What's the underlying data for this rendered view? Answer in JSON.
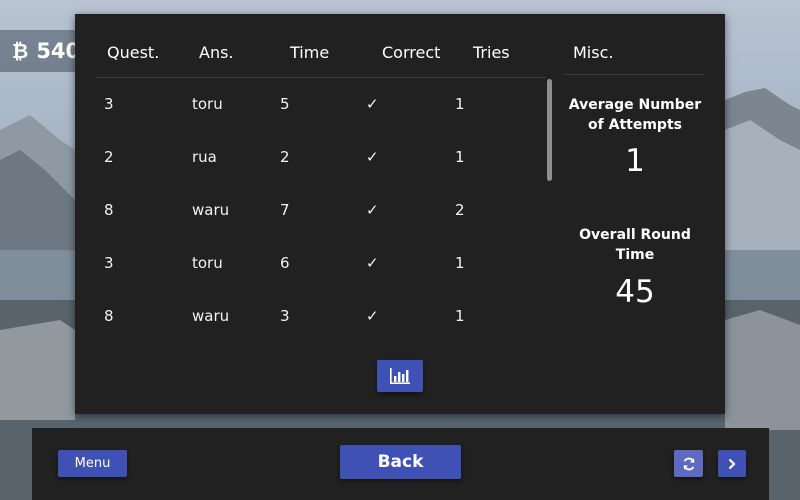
{
  "hud": {
    "coin_icon": "₿",
    "coins": "540"
  },
  "results_table": {
    "headers": {
      "question": "Quest.",
      "answer": "Ans.",
      "time": "Time",
      "correct": "Correct",
      "tries": "Tries"
    },
    "rows": [
      {
        "question": "3",
        "answer": "toru",
        "time": "5",
        "correct": "✓",
        "tries": "1"
      },
      {
        "question": "2",
        "answer": "rua",
        "time": "2",
        "correct": "✓",
        "tries": "1"
      },
      {
        "question": "8",
        "answer": "waru",
        "time": "7",
        "correct": "✓",
        "tries": "2"
      },
      {
        "question": "3",
        "answer": "toru",
        "time": "6",
        "correct": "✓",
        "tries": "1"
      },
      {
        "question": "8",
        "answer": "waru",
        "time": "3",
        "correct": "✓",
        "tries": "1"
      }
    ]
  },
  "misc": {
    "title": "Misc.",
    "avg_attempts_label": "Average Number of Attempts",
    "avg_attempts_value": "1",
    "round_time_label": "Overall Round Time",
    "round_time_value": "45"
  },
  "chart_button": {
    "icon": "bar-chart-icon"
  },
  "footer": {
    "menu_label": "Menu",
    "back_label": "Back",
    "refresh_icon": "refresh-icon",
    "next_icon": "chevron-right-icon"
  },
  "colors": {
    "panel": "#212121",
    "accent": "#3f51b5",
    "accent_light": "#5c6bc0"
  }
}
